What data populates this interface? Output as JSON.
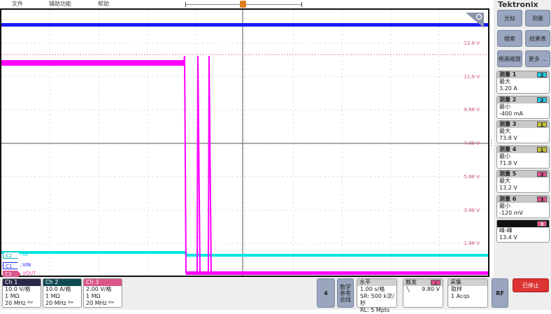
{
  "menu": {
    "file": "文件",
    "utility": "辅助功能",
    "help": "帮助"
  },
  "brand": "Tektronix",
  "side_buttons": [
    "光标",
    "测量",
    "搜索",
    "结果表",
    "框画缩放",
    "更多 ..."
  ],
  "measurements": [
    {
      "title": "测量 1",
      "source": "2",
      "type": "最大",
      "value": "3.20 A",
      "color": "#21c4e0"
    },
    {
      "title": "测量 2",
      "source": "2",
      "type": "最小",
      "value": "-400 mA",
      "color": "#21c4e0"
    },
    {
      "title": "测量 3",
      "source": "1",
      "type": "最大",
      "value": "73.8 V",
      "color": "#c4c032"
    },
    {
      "title": "测量 4",
      "source": "1",
      "type": "最小",
      "value": "71.8 V",
      "color": "#c4c032"
    },
    {
      "title": "测量 5",
      "source": "3",
      "type": "最大",
      "value": "13.2 V",
      "color": "#e0508a"
    },
    {
      "title": "测量 6",
      "source": "3",
      "type": "最小",
      "value": "-120 mV",
      "color": "#e0508a"
    },
    {
      "title": "",
      "source": "3",
      "type": "峰-峰",
      "value": "13.4 V",
      "color": "#e0508a"
    }
  ],
  "scale_labels": [
    "13.9 V",
    "11.9 V",
    "9.88 V",
    "7.88 V",
    "5.88 V",
    "3.88 V",
    "1.88 V"
  ],
  "traces": [
    {
      "tag": "C2",
      "label": "IO",
      "color": "#00e5e5"
    },
    {
      "tag": "C1",
      "label": "VIN",
      "color": "#1a1aff"
    },
    {
      "tag": "C3",
      "label": "VOUT",
      "color": "#ff00ff"
    }
  ],
  "channels": [
    {
      "name": "Ch 1",
      "scale": "10.0 V/格",
      "imp": "1 MΩ",
      "bw": "20 MHz",
      "color": "#2a2a4a"
    },
    {
      "name": "Ch 2",
      "scale": "10.0 A/格",
      "imp": "1 MΩ",
      "bw": "20 MHz",
      "color": "#0f4a52"
    },
    {
      "name": "Ch 3",
      "scale": "2.00 V/格",
      "imp": "1 MΩ",
      "bw": "20 MHz",
      "color": "#d9558a"
    }
  ],
  "add_channel": "4",
  "math_ref_bus": "数学参考总线",
  "horizontal": {
    "title": "水平",
    "scale": "1.00 s/格",
    "sr": "SR: 500 k次/秒",
    "rl": "RL: 5 Mpts"
  },
  "trigger": {
    "title": "触发",
    "source": "3",
    "level": "9.80 V",
    "slope": "falling"
  },
  "acquisition": {
    "title": "采集",
    "mode": "取样",
    "count": "1 Acqs"
  },
  "rf": "RF",
  "run_state": "已停止"
}
